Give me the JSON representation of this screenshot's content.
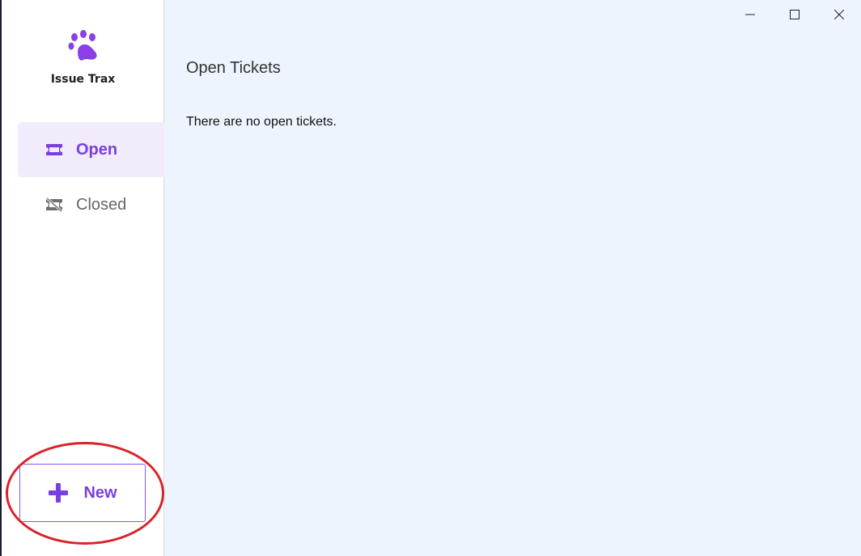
{
  "app": {
    "name": "Issue Trax",
    "accent_color": "#7a3fe0",
    "logo_icon": "paw-icon"
  },
  "sidebar": {
    "items": [
      {
        "label": "Open",
        "icon": "ticket-icon",
        "active": true
      },
      {
        "label": "Closed",
        "icon": "ticket-off-icon",
        "active": false
      }
    ],
    "new_button": {
      "label": "New",
      "icon": "plus-icon"
    }
  },
  "main": {
    "title": "Open Tickets",
    "empty_message": "There are no open tickets."
  },
  "window_controls": [
    "minimize",
    "maximize",
    "close"
  ],
  "annotation_color": "#d9232a"
}
